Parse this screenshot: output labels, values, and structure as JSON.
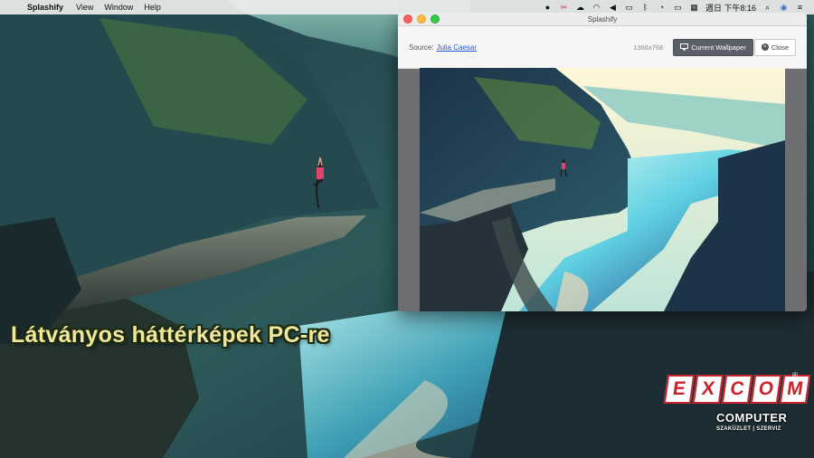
{
  "menubar": {
    "app_name": "Splashify",
    "menus": [
      "View",
      "Window",
      "Help"
    ],
    "clock": "週日 下午8:16"
  },
  "window": {
    "title": "Splashify",
    "source_label": "Source:",
    "source_author": "Julia Caesar",
    "resolution": "1366x768",
    "current_wallpaper_label": "Current Wallpaper",
    "close_label": "Close"
  },
  "overlay": {
    "headline": "Látványos háttérképek PC-re"
  },
  "logo": {
    "letters": [
      "E",
      "X",
      "C",
      "O",
      "M"
    ],
    "registered": "®",
    "line1": "COMPUTER",
    "line2": "SZAKÜZLET | SZERVIZ"
  },
  "colors": {
    "accent_red": "#c9242b",
    "headline_yellow": "#f2e69a",
    "link_blue": "#2a5bd7"
  }
}
